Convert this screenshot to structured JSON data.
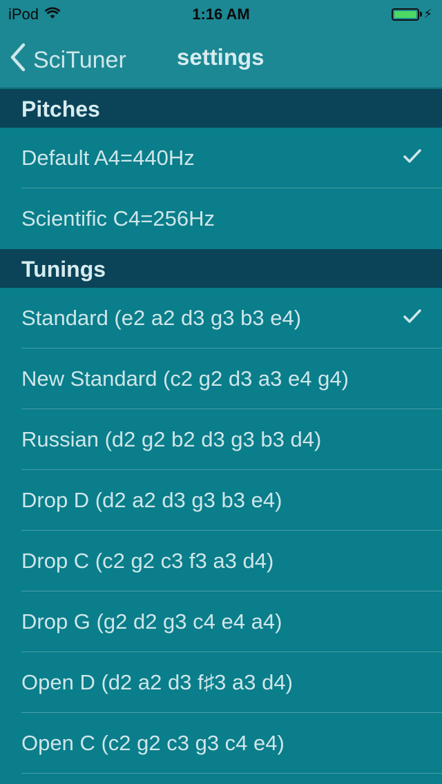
{
  "status_bar": {
    "carrier": "iPod",
    "time": "1:16 AM",
    "battery_level": 1.0,
    "battery_color": "#4cd964"
  },
  "nav": {
    "back_label": "SciTuner",
    "title": "settings"
  },
  "sections": {
    "pitches": {
      "header": "Pitches",
      "items": [
        {
          "label": "Default A4=440Hz",
          "selected": true
        },
        {
          "label": "Scientific C4=256Hz",
          "selected": false
        }
      ]
    },
    "tunings": {
      "header": "Tunings",
      "items": [
        {
          "label": "Standard (e2 a2 d3 g3 b3 e4)",
          "selected": true
        },
        {
          "label": "New Standard (c2 g2 d3 a3 e4 g4)",
          "selected": false
        },
        {
          "label": "Russian (d2 g2 b2 d3 g3 b3 d4)",
          "selected": false
        },
        {
          "label": "Drop D (d2 a2 d3 g3 b3 e4)",
          "selected": false
        },
        {
          "label": "Drop C (c2 g2 c3 f3 a3 d4)",
          "selected": false
        },
        {
          "label": "Drop G (g2 d2 g3 c4 e4 a4)",
          "selected": false
        },
        {
          "label": "Open D (d2 a2 d3 f♯3 a3 d4)",
          "selected": false
        },
        {
          "label": "Open C (c2 g2 c3 g3 c4 e4)",
          "selected": false
        }
      ]
    }
  },
  "colors": {
    "background": "#0a7e8a",
    "section_header": "#0b4358",
    "nav_bar": "#1c8894",
    "text": "#cfe6ea"
  }
}
